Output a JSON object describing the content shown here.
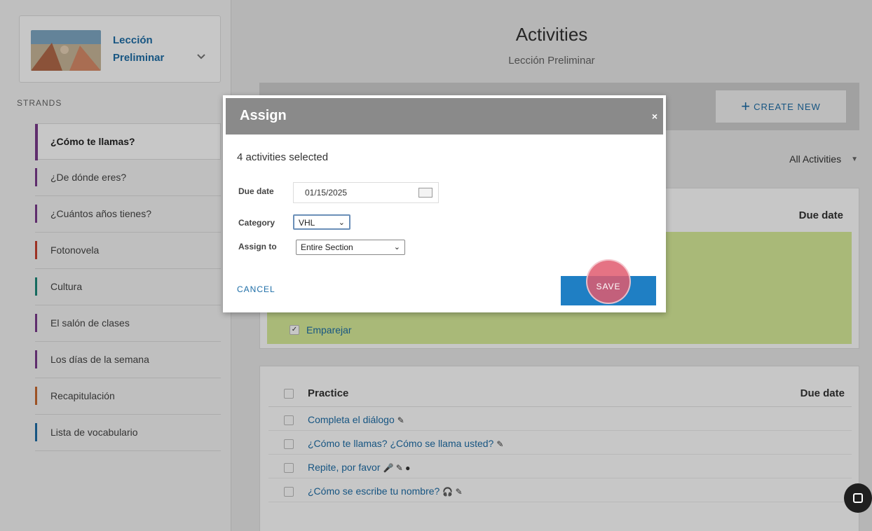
{
  "sidebar": {
    "lesson": {
      "title_line1": "Lección",
      "title_line2": "Preliminar"
    },
    "strands_label": "STRANDS",
    "items": [
      {
        "label": "¿Cómo te llamas?",
        "color": "#7a3a8c",
        "active": true
      },
      {
        "label": "¿De dónde eres?",
        "color": "#7a3a8c"
      },
      {
        "label": "¿Cuántos años tienes?",
        "color": "#7a3a8c"
      },
      {
        "label": "Fotonovela",
        "color": "#c8412f"
      },
      {
        "label": "Cultura",
        "color": "#1d8a7a"
      },
      {
        "label": "El salón de clases",
        "color": "#7a3a8c"
      },
      {
        "label": "Los días de la semana",
        "color": "#7a3a8c"
      },
      {
        "label": "Recapitulación",
        "color": "#c86a2f"
      },
      {
        "label": "Lista de vocabulario",
        "color": "#1e6ea7"
      }
    ]
  },
  "main": {
    "title": "Activities",
    "subtitle": "Lección Preliminar",
    "create_new": "CREATE NEW",
    "filter": "All Activities",
    "panel1": {
      "due_header": "Due date",
      "row_emparejar": "Emparejar"
    },
    "practice": {
      "header": "Practice",
      "due_header": "Due date",
      "rows": [
        {
          "label": "Completa el diálogo",
          "icons": "✎"
        },
        {
          "label": "¿Cómo te llamas? ¿Cómo se llama usted?",
          "icons": "✎"
        },
        {
          "label": "Repite, por favor",
          "icons": "🎤 ✎ ●"
        },
        {
          "label": "¿Cómo se escribe tu nombre?",
          "icons": "🎧 ✎"
        }
      ]
    }
  },
  "modal": {
    "title": "Assign",
    "close": "×",
    "selected_text": "4 activities selected",
    "due_date_label": "Due date",
    "due_date_value": "01/15/2025",
    "category_label": "Category",
    "category_value": "VHL",
    "assign_to_label": "Assign to",
    "assign_to_value": "Entire Section",
    "cancel_label": "CANCEL",
    "save_label": "SAVE"
  },
  "colors": {
    "accent": "#1e6ea7",
    "save_button": "#1f7fc4",
    "highlight_green": "#d9ee9a"
  }
}
